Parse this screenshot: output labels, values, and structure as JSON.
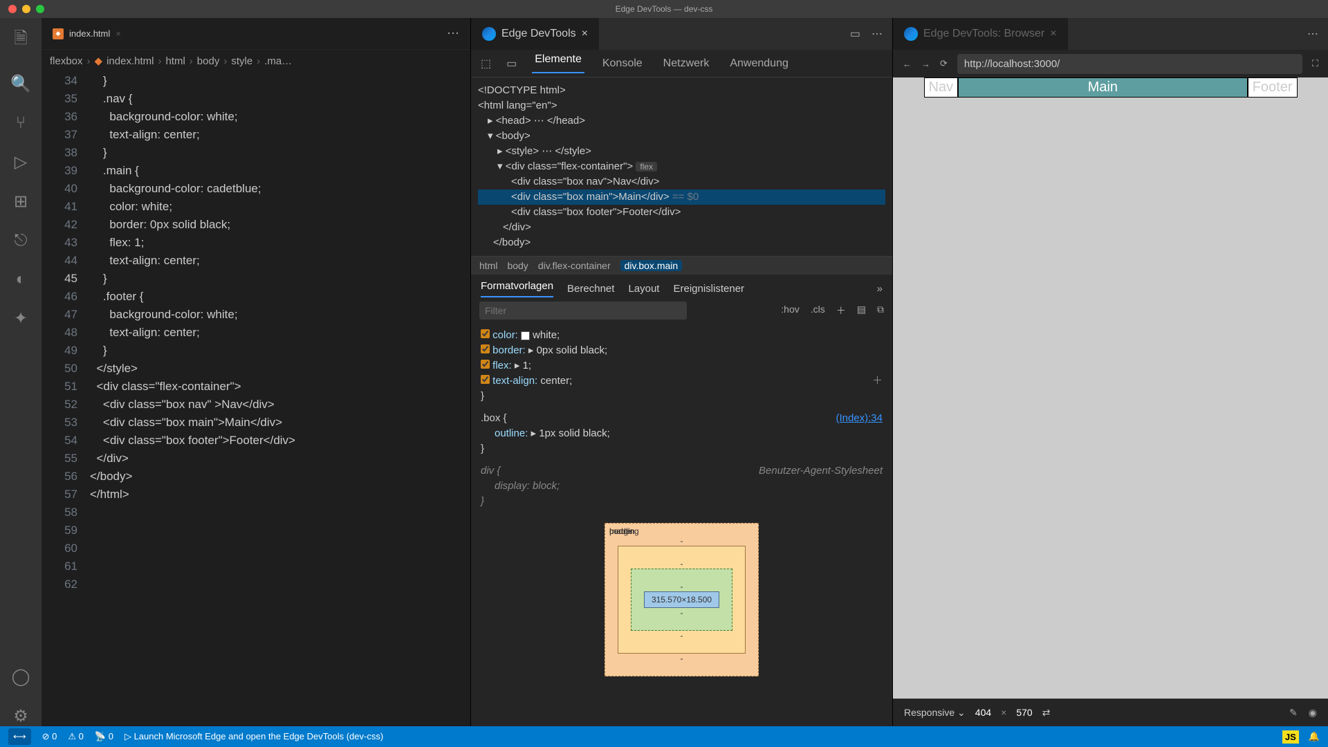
{
  "window": {
    "title": "Edge DevTools — dev-css"
  },
  "editor": {
    "tab_label": "index.html",
    "breadcrumbs": [
      "flexbox",
      "index.html",
      "html",
      "body",
      "style",
      ".ma…"
    ],
    "line_start": 34,
    "highlight_line": 45,
    "lines": [
      "    }",
      "",
      "    .nav {",
      "      background-color: white;",
      "      text-align: center;",
      "    }",
      "",
      "    .main {",
      "      background-color: cadetblue;",
      "      color: white;",
      "      border: 0px solid black;",
      "      flex: 1;",
      "      text-align: center;",
      "    }",
      "",
      "    .footer {",
      "      background-color: white;",
      "      text-align: center;",
      "    }",
      "  </style>",
      "",
      "  <div class=\"flex-container\">",
      "    <div class=\"box nav\" >Nav</div>",
      "    <div class=\"box main\">Main</div>",
      "    <div class=\"box footer\">Footer</div>",
      "  </div>",
      "</body>",
      "</html>",
      ""
    ]
  },
  "devtools": {
    "tab_label": "Edge DevTools",
    "toolbar_tabs": {
      "elements": "Elemente",
      "console": "Konsole",
      "network": "Netzwerk",
      "application": "Anwendung"
    },
    "dom_crumbs": [
      "html",
      "body",
      "div.flex-container",
      "div.box.main"
    ],
    "style_tabs": {
      "styles": "Formatvorlagen",
      "computed": "Berechnet",
      "layout": "Layout",
      "listeners": "Ereignislistener"
    },
    "filter_placeholder": "Filter",
    "hov": ":hov",
    "cls": ".cls",
    "decl": {
      "color": "color:",
      "color_v": "white;",
      "border": "border:",
      "border_v": "0px solid  black;",
      "flex": "flex:",
      "flex_v": "1;",
      "ta": "text-align:",
      "ta_v": "center;"
    },
    "box_sel": ".box {",
    "box_link": "(Index):34",
    "outline": "outline:",
    "outline_v": "1px solid  black;",
    "div_sel": "div {",
    "ua": "Benutzer-Agent-Stylesheet",
    "display": "display:",
    "display_v": "block;",
    "boxmodel": {
      "margin": "margin",
      "border": "border",
      "padding": "padding",
      "content": "315.570×18.500"
    }
  },
  "dom": {
    "doctype": "<!DOCTYPE html>",
    "html_open": "<html lang=\"en\">",
    "head": "<head> ⋯ </head>",
    "body": "<body>",
    "style": "<style> ⋯ </style>",
    "flexcont_open": "<div class=\"flex-container\">",
    "flex_badge": "flex",
    "nav": "<div class=\"box nav\">Nav</div>",
    "main": "<div class=\"box main\">Main</div>",
    "main_ghost": " == $0",
    "footer": "<div class=\"box footer\">Footer</div>",
    "div_close": "</div>",
    "body_close": "</body>"
  },
  "browser": {
    "tab_label": "Edge DevTools: Browser",
    "url": "http://localhost:3000/",
    "nav": "Nav",
    "main": "Main",
    "footer": "Footer",
    "device": "Responsive",
    "w": "404",
    "h": "570"
  },
  "status": {
    "errors": "0",
    "warnings": "0",
    "ports": "0",
    "launch": "Launch Microsoft Edge and open the Edge DevTools (dev-css)"
  }
}
